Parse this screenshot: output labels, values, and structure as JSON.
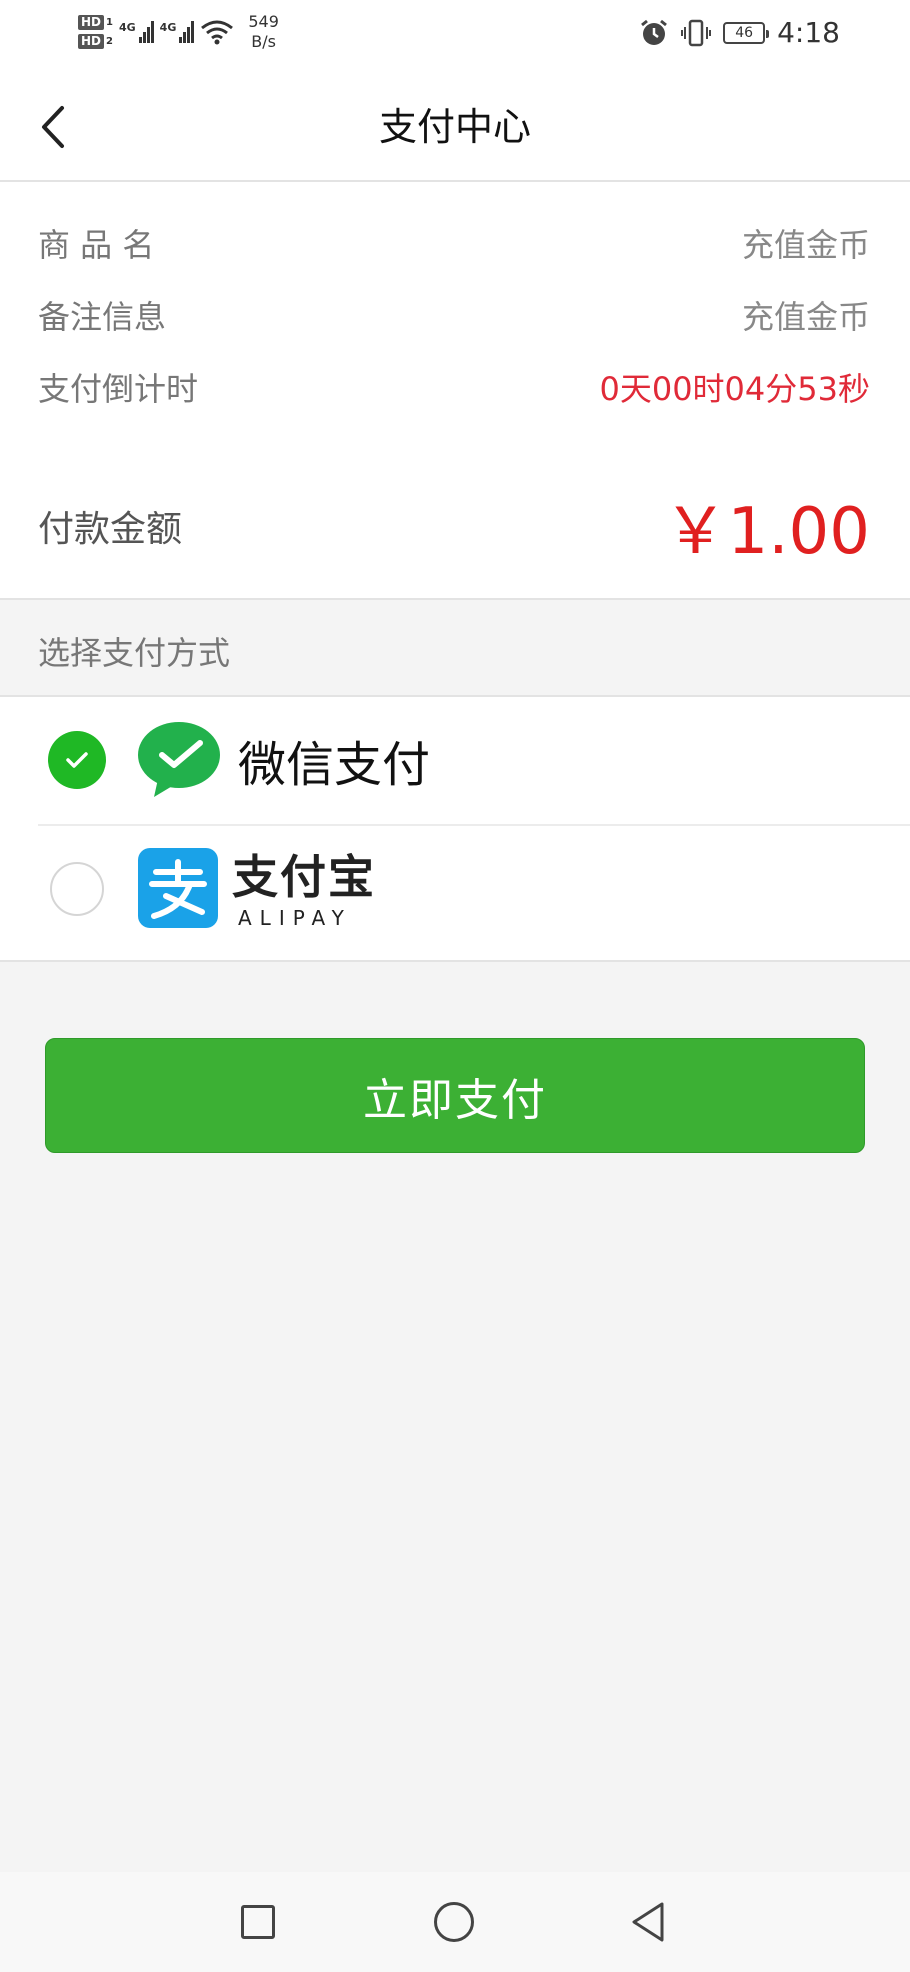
{
  "status_bar": {
    "sim1": "HD",
    "sim1_index": "1",
    "sim2": "HD",
    "sim2_index": "2",
    "signal1_label": "4G",
    "signal2_label": "4G",
    "speed_value": "549",
    "speed_unit": "B/s",
    "battery": "46",
    "time": "4:18"
  },
  "header": {
    "title": "支付中心",
    "back_icon": "chevron-left-icon"
  },
  "order": {
    "product_label": "商 品 名",
    "product_value": "充值金币",
    "remark_label": "备注信息",
    "remark_value": "充值金币",
    "countdown_label": "支付倒计时",
    "countdown_value": "0天00时04分53秒",
    "amount_label": "付款金额",
    "amount_value": "￥1.00"
  },
  "payment": {
    "section_title": "选择支付方式",
    "methods": [
      {
        "name": "微信支付",
        "selected": true,
        "icon": "wechat-pay-icon"
      },
      {
        "name": "支付宝",
        "sub": "ALIPAY",
        "selected": false,
        "icon": "alipay-icon"
      }
    ]
  },
  "actions": {
    "pay_label": "立即支付"
  },
  "colors": {
    "accent_green": "#3cb034",
    "check_green": "#1fb825",
    "alert_red": "#e02a38",
    "alipay_blue": "#1aa2e8"
  },
  "system_nav": {
    "recent_icon": "square-recents-icon",
    "home_icon": "circle-home-icon",
    "back_icon": "triangle-back-icon"
  }
}
